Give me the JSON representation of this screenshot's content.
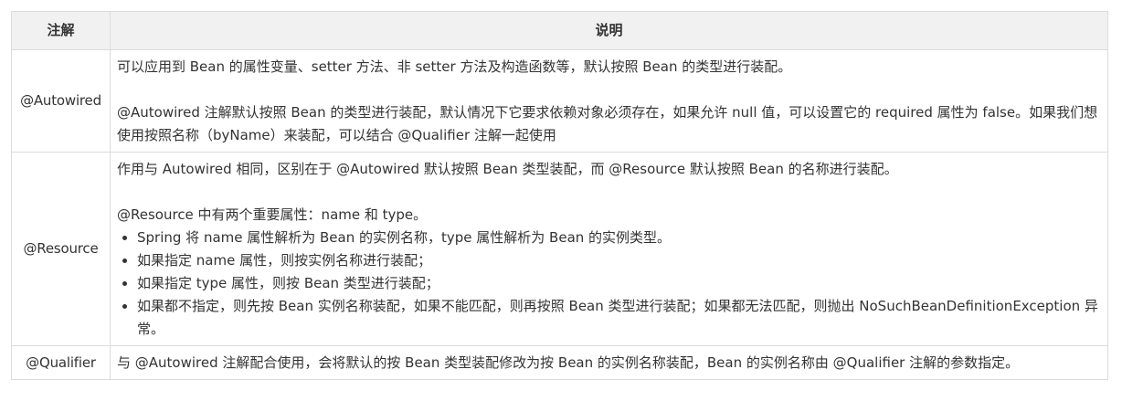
{
  "header": {
    "col1": "注解",
    "col2": "说明"
  },
  "rows": [
    {
      "name": "@Autowired",
      "p1": "可以应用到 Bean 的属性变量、setter 方法、非 setter 方法及构造函数等，默认按照 Bean 的类型进行装配。",
      "p2": "@Autowired 注解默认按照 Bean 的类型进行装配，默认情况下它要求依赖对象必须存在，如果允许 null 值，可以设置它的 required 属性为 false。如果我们想使用按照名称（byName）来装配，可以结合 @Qualifier 注解一起使用"
    },
    {
      "name": "@Resource",
      "p1": "作用与 Autowired 相同，区别在于 @Autowired 默认按照 Bean 类型装配，而 @Resource 默认按照 Bean 的名称进行装配。",
      "p2": "@Resource 中有两个重要属性：name 和 type。",
      "bullets": [
        "Spring 将 name 属性解析为 Bean 的实例名称，type 属性解析为 Bean 的实例类型。",
        "如果指定 name 属性，则按实例名称进行装配；",
        "如果指定 type 属性，则按 Bean 类型进行装配；",
        "如果都不指定，则先按 Bean 实例名称装配，如果不能匹配，则再按照 Bean 类型进行装配；如果都无法匹配，则抛出 NoSuchBeanDefinitionException 异常。"
      ]
    },
    {
      "name": "@Qualifier",
      "p1": "与 @Autowired 注解配合使用，会将默认的按 Bean 类型装配修改为按 Bean 的实例名称装配，Bean 的实例名称由 @Qualifier 注解的参数指定。"
    }
  ]
}
